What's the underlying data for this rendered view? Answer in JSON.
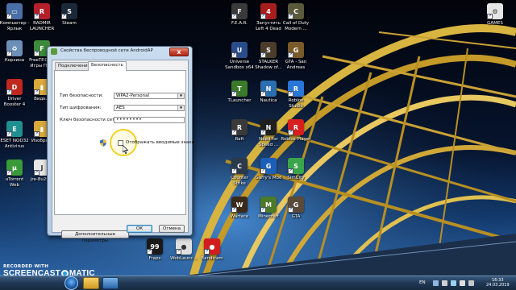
{
  "desktop_icons": [
    {
      "label": "Компьютер -\nЯрлык",
      "color": "#4a6fa8",
      "glyph": "▭",
      "icon": "computer-icon"
    },
    {
      "label": "RADMIR\nLAUNCHER",
      "color": "#b3202a",
      "glyph": "R",
      "icon": "radmir-icon"
    },
    {
      "label": "Steam",
      "color": "#1b2838",
      "glyph": "S",
      "icon": "steam-icon"
    },
    {
      "label": "Корзина",
      "color": "#6b8fb8",
      "glyph": "♻",
      "icon": "recycle-bin-icon"
    },
    {
      "label": "FreeTP.ORG\nИгры По...",
      "color": "#3c8a3c",
      "glyph": "F",
      "icon": "freetp-icon"
    },
    {
      "label": "Driver\nBooster 4",
      "color": "#c0281f",
      "glyph": "D",
      "icon": "driver-booster-icon"
    },
    {
      "label": "Виде...",
      "color": "#d9a93c",
      "glyph": "▮",
      "icon": "folder-icon"
    },
    {
      "label": "ESET NOD32\nAntivirus",
      "color": "#1f8f8f",
      "glyph": "E",
      "icon": "eset-icon"
    },
    {
      "label": "Изобра...",
      "color": "#d9a93c",
      "glyph": "▮",
      "icon": "folder-icon"
    },
    {
      "label": "uTorrent\nWeb",
      "color": "#3a9a3a",
      "glyph": "μ",
      "icon": "utorrent-icon"
    },
    {
      "label": "jre-8u20...",
      "color": "#e6e6e6",
      "glyph": "J",
      "icon": "java-icon"
    },
    {
      "label": "F.E.A.R.",
      "color": "#3a3a3a",
      "glyph": "F",
      "icon": "fear-icon"
    },
    {
      "label": "Запустить\nLeft 4 Dead",
      "color": "#a81e1e",
      "glyph": "4",
      "icon": "left4dead-icon"
    },
    {
      "label": "Call of Duty\nModern ...",
      "color": "#5a5a3c",
      "glyph": "C",
      "icon": "cod-icon"
    },
    {
      "label": "Universe\nSandbox x64",
      "color": "#2a4d8a",
      "glyph": "U",
      "icon": "universe-sandbox-icon"
    },
    {
      "label": "STALKER\nShadow of...",
      "color": "#4b3d2b",
      "glyph": "S",
      "icon": "stalker-icon"
    },
    {
      "label": "GTA - San\nAndreas",
      "color": "#7a5a2a",
      "glyph": "G",
      "icon": "gta-icon"
    },
    {
      "label": "TLauncher",
      "color": "#3b7a2a",
      "glyph": "T",
      "icon": "tlauncher-icon"
    },
    {
      "label": "Nautica",
      "color": "#2a6fb0",
      "glyph": "N",
      "icon": "nautica-icon"
    },
    {
      "label": "Roblox\nStudio",
      "color": "#2877d8",
      "glyph": "R",
      "icon": "roblox-studio-icon"
    },
    {
      "label": "Raft",
      "color": "#3a3a3a",
      "glyph": "R",
      "icon": "raft-icon"
    },
    {
      "label": "Need for\nSpeed ...",
      "color": "#1f1f1f",
      "glyph": "N",
      "icon": "nfs-icon"
    },
    {
      "label": "Roblox Player",
      "color": "#d81e1e",
      "glyph": "R",
      "icon": "roblox-player-icon"
    },
    {
      "label": "Counter\nStrike",
      "color": "#2b3a4a",
      "glyph": "C",
      "icon": "counter-strike-icon"
    },
    {
      "label": "Garry's Mod",
      "color": "#1c5fb8",
      "glyph": "G",
      "icon": "garrys-mod-icon"
    },
    {
      "label": "SimCity",
      "color": "#3aa54a",
      "glyph": "S",
      "icon": "simcity-icon"
    },
    {
      "label": "Warface",
      "color": "#3a2a1a",
      "glyph": "W",
      "icon": "warface-icon"
    },
    {
      "label": "Minecraft",
      "color": "#4b7a2a",
      "glyph": "M",
      "icon": "minecraft-icon"
    },
    {
      "label": "GTA",
      "color": "#5a4a3a",
      "glyph": "G",
      "icon": "gta-4-icon"
    },
    {
      "label": "Fraps",
      "color": "#1a1a1a",
      "glyph": "99",
      "icon": "fraps-icon"
    },
    {
      "label": "WebLaunc...",
      "color": "#e0e0e0",
      "glyph": "●",
      "icon": "weblauncher-icon"
    },
    {
      "label": "Bandicam",
      "color": "#d01e1e",
      "glyph": "●",
      "icon": "bandicam-icon"
    },
    {
      "label": "GAMES",
      "color": "#e6e6e6",
      "glyph": "⚙",
      "icon": "games-icon"
    }
  ],
  "dialog": {
    "title": "Свойства беспроводной сети AndroidAP",
    "close": "x",
    "tabs": [
      "Подключение",
      "Безопасность"
    ],
    "active_tab": 1,
    "security_type_label": "Тип безопасности:",
    "security_type_value": "WPA2-Personal",
    "encryption_label": "Тип шифрования:",
    "encryption_value": "AES",
    "key_label": "Ключ безопасности сети",
    "key_value": "••••••••",
    "show_chars_label": "Отображать вводимые знаки",
    "advanced_button": "Дополнительные параметры",
    "ok_button": "ОК",
    "cancel_button": "Отмена"
  },
  "watermark": {
    "top": "RECORDED WITH",
    "left": "SCREENCAST",
    "right": "MATIC"
  },
  "taskbar": {
    "language": "EN",
    "time": "16:33",
    "date": "24.03.2019"
  }
}
